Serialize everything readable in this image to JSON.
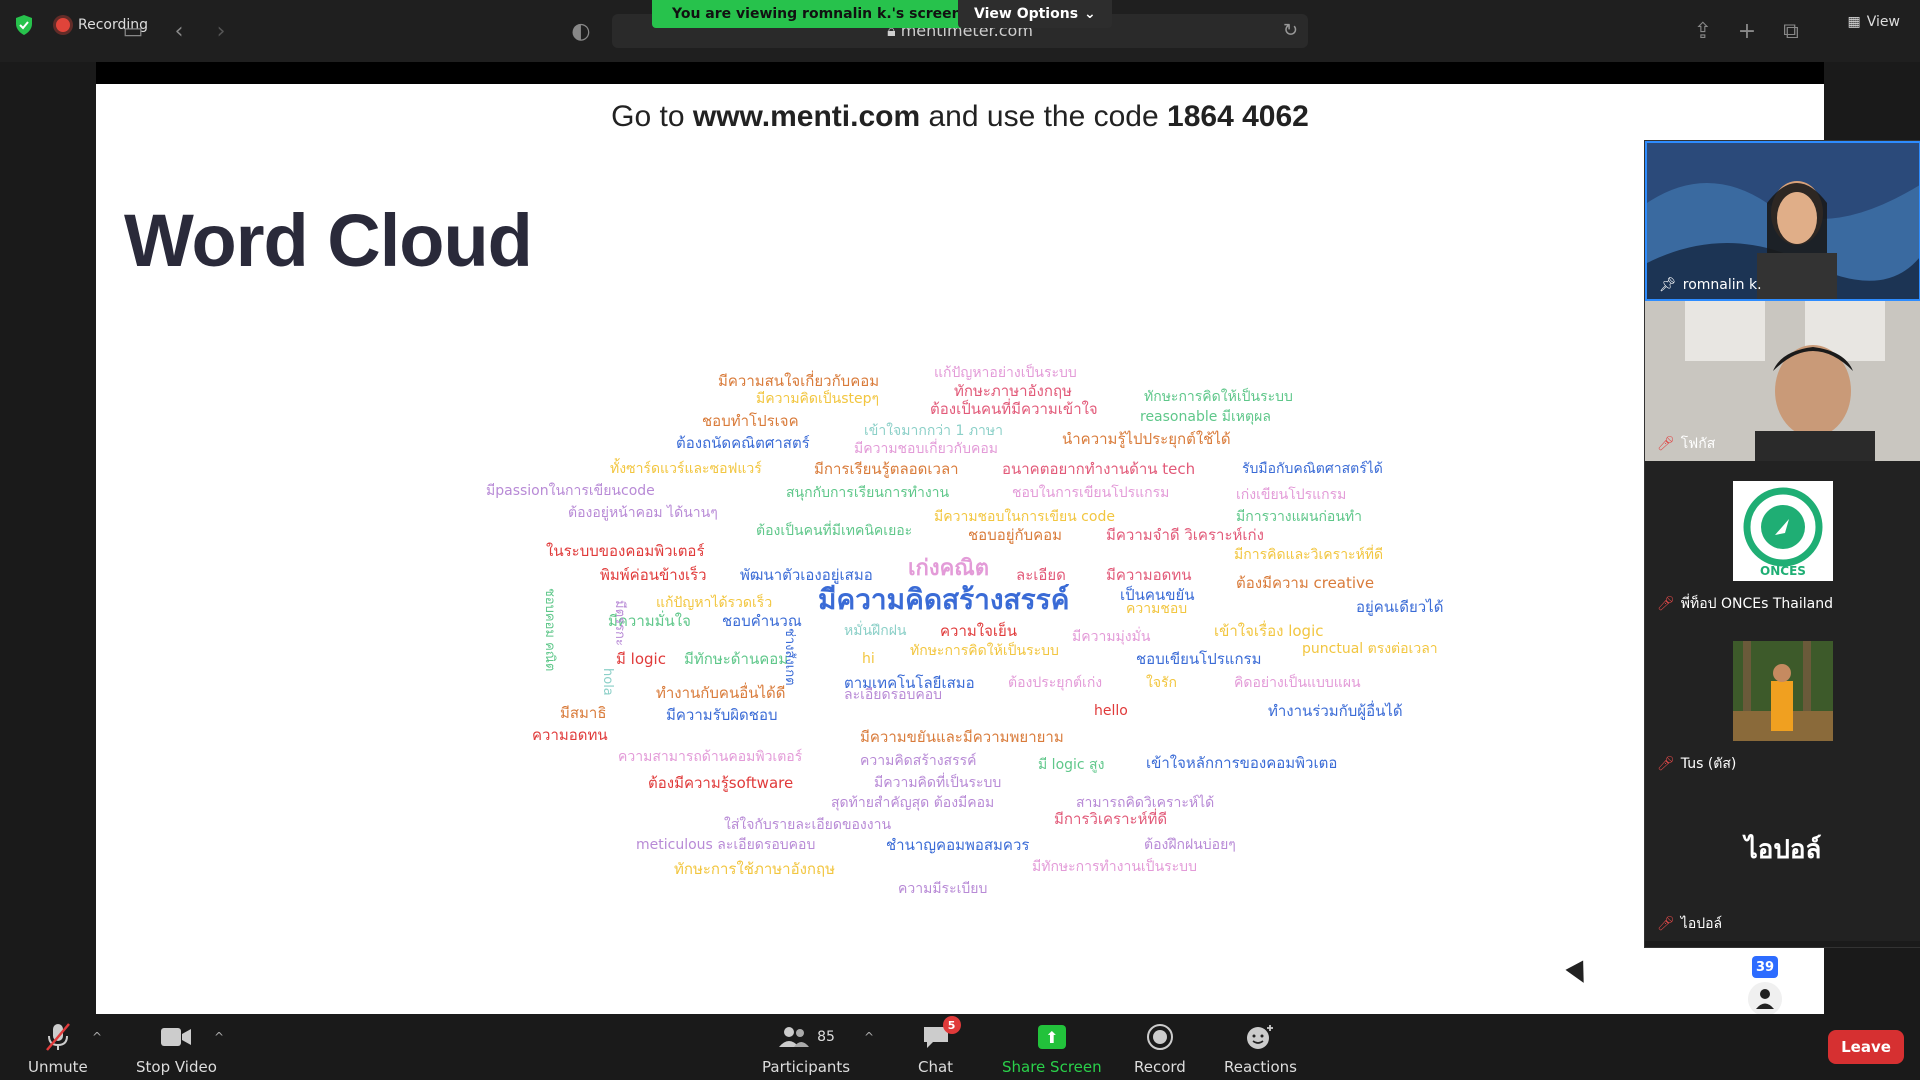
{
  "topbar": {
    "recording_label": "Recording",
    "viewing_banner": "You are viewing romnalin k.'s screen",
    "view_options_label": "View Options",
    "url": "mentimeter.com",
    "view_label": "View"
  },
  "slide": {
    "code_prefix": "Go to ",
    "code_site": "www.menti.com",
    "code_mid": " and use the code ",
    "code_number": "1864 4062",
    "title": "Word Cloud"
  },
  "word_cloud": [
    {
      "text": "แก้ปัญหาอย่างเป็นระบบ",
      "color": "#e39bd8"
    },
    {
      "text": "มีความสนใจเกี่ยวกับคอม",
      "color": "#d97b3a"
    },
    {
      "text": "ทักษะภาษาอังกฤษ",
      "color": "#e25a79"
    },
    {
      "text": "มีความคิดเป็นstepๆ",
      "color": "#f2c640"
    },
    {
      "text": "ต้องเป็นคนที่มีความเข้าใจ",
      "color": "#e25a79"
    },
    {
      "text": "ทักษะการคิดให้เป็นระบบ",
      "color": "#5fc78a"
    },
    {
      "text": "ชอบทำโปรเจค",
      "color": "#d97b3a"
    },
    {
      "text": "reasonable มีเหตุผล",
      "color": "#5fc78a"
    },
    {
      "text": "เข้าใจมากกว่า 1 ภาษา",
      "color": "#8cd0c8"
    },
    {
      "text": "ต้องถนัดคณิตศาสตร์",
      "color": "#3a6bd6"
    },
    {
      "text": "มีความชอบเกี่ยวกับคอม",
      "color": "#e39bd8"
    },
    {
      "text": "นำความรู้ไปประยุกต์ใช้ได้",
      "color": "#d97b3a"
    },
    {
      "text": "ทั้งซาร์ดแวร์และซอฟแวร์",
      "color": "#f2c640"
    },
    {
      "text": "มีการเรียนรู้ตลอดเวลา",
      "color": "#d97b3a"
    },
    {
      "text": "อนาคตอยากทำงานด้าน tech",
      "color": "#e25a79"
    },
    {
      "text": "รับมือกับคณิตศาสตร์ได้",
      "color": "#3a6bd6"
    },
    {
      "text": "มีpassionในการเขียนcode",
      "color": "#b88ad6"
    },
    {
      "text": "สนุกกับการเรียนการทำงาน",
      "color": "#5fc78a"
    },
    {
      "text": "ชอบในการเขียนโปรแกรม",
      "color": "#e39bd8"
    },
    {
      "text": "เก่งเขียนโปรแกรม",
      "color": "#e39bd8"
    },
    {
      "text": "ต้องอยู่หน้าคอม ได้นานๆ",
      "color": "#b88ad6"
    },
    {
      "text": "มีความชอบในการเขียน code",
      "color": "#f2c640"
    },
    {
      "text": "มีการวางแผนก่อนทำ",
      "color": "#5fc78a"
    },
    {
      "text": "ต้องเป็นคนที่มีเทคนิคเยอะ",
      "color": "#5fc78a"
    },
    {
      "text": "ชอบอยู่กับคอม",
      "color": "#d97b3a"
    },
    {
      "text": "มีความจำดี วิเคราะห์เก่ง",
      "color": "#e25a79"
    },
    {
      "text": "ในระบบของคอมพิวเตอร์",
      "color": "#e03a3a"
    },
    {
      "text": "มีการคิดและวิเคราะห์ที่ดี",
      "color": "#f2c640"
    },
    {
      "text": "พิมพ์ค่อนข้างเร็ว",
      "color": "#e03a3a"
    },
    {
      "text": "พัฒนาตัวเองอยู่เสมอ",
      "color": "#3a6bd6"
    },
    {
      "text": "เก่งคณิต",
      "color": "#e39bd8"
    },
    {
      "text": "ละเอียด",
      "color": "#e25a79"
    },
    {
      "text": "มีความอดทน",
      "color": "#e25a79"
    },
    {
      "text": "ต้องมีความ creative",
      "color": "#d97b3a"
    },
    {
      "text": "เป็นคนขยัน",
      "color": "#3a6bd6"
    },
    {
      "text": "อยู่คนเดียวได้",
      "color": "#3a6bd6"
    },
    {
      "text": "แก้ปัญหาได้รวดเร็ว",
      "color": "#f2c640"
    },
    {
      "text": "มีความคิดสร้างสรรค์",
      "color": "#3a6bd6"
    },
    {
      "text": "ความชอบ",
      "color": "#f2c640"
    },
    {
      "text": "มีความมั่นใจ",
      "color": "#5fc78a"
    },
    {
      "text": "ชอบคำนวณ",
      "color": "#3a6bd6"
    },
    {
      "text": "หมั่นฝึกฝน",
      "color": "#8cd0c8"
    },
    {
      "text": "ความใจเย็น",
      "color": "#e03a3a"
    },
    {
      "text": "มีความมุ่งมั่น",
      "color": "#e39bd8"
    },
    {
      "text": "เข้าใจเรื่อง logic",
      "color": "#f2c640"
    },
    {
      "text": "มี logic",
      "color": "#e03a3a"
    },
    {
      "text": "มีทักษะด้านคอม",
      "color": "#5fc78a"
    },
    {
      "text": "hi",
      "color": "#f2c640"
    },
    {
      "text": "ทักษะการคิดให้เป็นระบบ",
      "color": "#f2c640"
    },
    {
      "text": "ชอบเขียนโปรแกรม",
      "color": "#3a6bd6"
    },
    {
      "text": "punctual ตรงต่อเวลา",
      "color": "#f2c640"
    },
    {
      "text": "ตามเทคโนโลยีเสมอ",
      "color": "#3a6bd6"
    },
    {
      "text": "ต้องประยุกต์เก่ง",
      "color": "#e39bd8"
    },
    {
      "text": "ใจรัก",
      "color": "#f2c640"
    },
    {
      "text": "คิดอย่างเป็นแบบแผน",
      "color": "#e39bd8"
    },
    {
      "text": "ทำงานกับคนอื่นได้ดี",
      "color": "#d97b3a"
    },
    {
      "text": "ละเอียดรอบคอบ",
      "color": "#b88ad6"
    },
    {
      "text": "hello",
      "color": "#e03a3a"
    },
    {
      "text": "มีความรับผิดชอบ",
      "color": "#3a6bd6"
    },
    {
      "text": "ทำงานร่วมกับผู้อื่นได้",
      "color": "#3a6bd6"
    },
    {
      "text": "มีสมาธิ",
      "color": "#d97b3a"
    },
    {
      "text": "ความอดทน",
      "color": "#e03a3a"
    },
    {
      "text": "มีความขยันและมีความพยายาม",
      "color": "#d97b3a"
    },
    {
      "text": "ความสามารถด้านคอมพิวเตอร์",
      "color": "#e39bd8"
    },
    {
      "text": "ความคิดสร้างสรรค์",
      "color": "#b88ad6"
    },
    {
      "text": "มี logic สูง",
      "color": "#5fc78a"
    },
    {
      "text": "เข้าใจหลักการของคอมพิวเตอ",
      "color": "#3a6bd6"
    },
    {
      "text": "ต้องมีความรู้software",
      "color": "#e03a3a"
    },
    {
      "text": "มีความคิดที่เป็นระบบ",
      "color": "#b88ad6"
    },
    {
      "text": "สุดท้ายสำคัญสุด ต้องมีคอม",
      "color": "#b88ad6"
    },
    {
      "text": "สามารถคิดวิเคราะห์ได้",
      "color": "#b88ad6"
    },
    {
      "text": "ใส่ใจกับรายละเอียดของงาน",
      "color": "#b88ad6"
    },
    {
      "text": "มีการวิเคราะห์ที่ดี",
      "color": "#e25a79"
    },
    {
      "text": "meticulous ละเอียดรอบคอบ",
      "color": "#b88ad6"
    },
    {
      "text": "ชำนาญคอมพอสมควร",
      "color": "#3a6bd6"
    },
    {
      "text": "ต้องฝึกฝนบ่อยๆ",
      "color": "#b88ad6"
    },
    {
      "text": "ทักษะการใช้ภาษาอังกฤษ",
      "color": "#f2c640"
    },
    {
      "text": "มีทักษะการทำงานเป็นระบบ",
      "color": "#e39bd8"
    },
    {
      "text": "ความมีระเบียบ",
      "color": "#b88ad6"
    },
    {
      "text": "ชอบคอม คณิต",
      "color": "#5fc78a"
    },
    {
      "text": "มีตรรกะ",
      "color": "#b88ad6"
    },
    {
      "text": "hola",
      "color": "#8cd0c8"
    },
    {
      "text": "ช่างสังเกต",
      "color": "#3a6bd6"
    }
  ],
  "participants": [
    {
      "name": "romnalin k.",
      "pinned": true
    },
    {
      "name": "โฟกัส",
      "muted": true
    },
    {
      "name": "พี่ท็อป ONCEs Thailand",
      "muted": true,
      "logo_text": "ONCES"
    },
    {
      "name": "Tus (ตัส)",
      "muted": true
    },
    {
      "name": "ไอปอล์",
      "muted": true,
      "display": "ไอปอล์"
    }
  ],
  "participant_overflow_count": "39",
  "bottombar": {
    "unmute": "Unmute",
    "stop_video": "Stop Video",
    "participants": "Participants",
    "participants_count": "85",
    "chat": "Chat",
    "chat_badge": "5",
    "share_screen": "Share Screen",
    "record": "Record",
    "reactions": "Reactions",
    "leave": "Leave"
  },
  "colors": {
    "share_green": "#22c23b",
    "leave_red": "#d63031",
    "active_border": "#2d8cff"
  }
}
